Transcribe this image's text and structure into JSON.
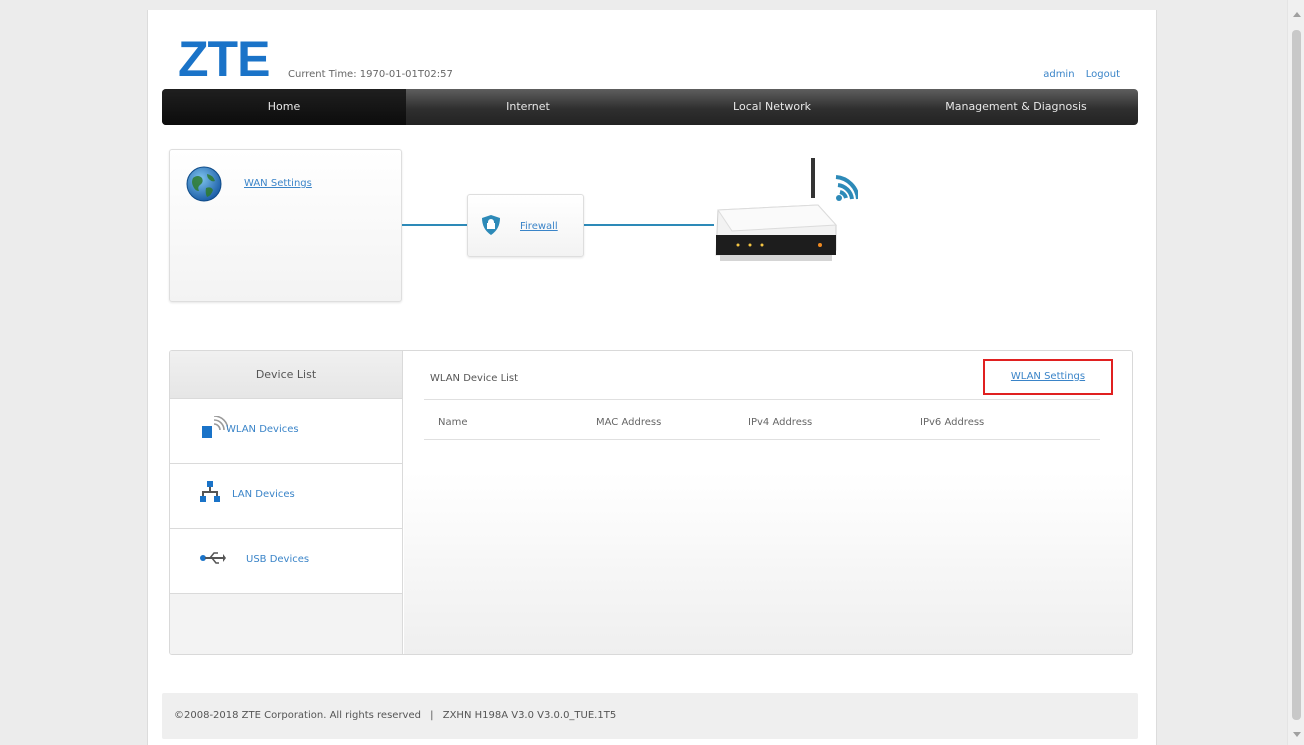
{
  "header": {
    "logo": "ZTE",
    "current_time_label": "Current Time:",
    "current_time_value": "1970-01-01T02:57",
    "user": "admin",
    "logout": "Logout"
  },
  "nav": {
    "items": [
      "Home",
      "Internet",
      "Local Network",
      "Management & Diagnosis"
    ],
    "active": "Home"
  },
  "topology": {
    "wan_settings_label": "WAN Settings",
    "firewall_label": "Firewall"
  },
  "device_list": {
    "title": "Device List",
    "tabs": [
      {
        "label": "WLAN Devices",
        "icon": "wlan-device-icon"
      },
      {
        "label": "LAN Devices",
        "icon": "lan-network-icon"
      },
      {
        "label": "USB Devices",
        "icon": "usb-icon"
      }
    ],
    "panel_title": "WLAN Device List",
    "settings_button": "WLAN Settings",
    "columns": [
      "Name",
      "MAC Address",
      "IPv4 Address",
      "IPv6 Address"
    ],
    "rows": []
  },
  "footer": {
    "copyright": "©2008-2018 ZTE Corporation. All rights reserved",
    "separator": "|",
    "version": "ZXHN H198A V3.0 V3.0.0_TUE.1T5"
  },
  "colors": {
    "brand": "#1a73c8",
    "link": "#3a84c8",
    "nav_bg": "#2f2f2f",
    "line": "#2d8ab8",
    "highlight": "#e02020"
  }
}
